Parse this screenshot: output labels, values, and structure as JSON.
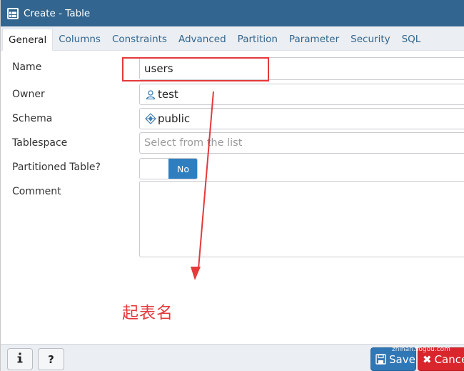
{
  "window": {
    "title": "Create - Table"
  },
  "tabs": [
    {
      "label": "General",
      "active": true
    },
    {
      "label": "Columns",
      "active": false
    },
    {
      "label": "Constraints",
      "active": false
    },
    {
      "label": "Advanced",
      "active": false
    },
    {
      "label": "Partition",
      "active": false
    },
    {
      "label": "Parameter",
      "active": false
    },
    {
      "label": "Security",
      "active": false
    },
    {
      "label": "SQL",
      "active": false
    }
  ],
  "form": {
    "name": {
      "label": "Name",
      "value": "users"
    },
    "owner": {
      "label": "Owner",
      "value": "test",
      "icon": "user-icon"
    },
    "schema": {
      "label": "Schema",
      "value": "public",
      "icon": "schema-icon"
    },
    "tablespace": {
      "label": "Tablespace",
      "placeholder": "Select from the list"
    },
    "partitioned": {
      "label": "Partitioned Table?",
      "value": "No"
    },
    "comment": {
      "label": "Comment",
      "value": ""
    }
  },
  "annotation": {
    "text": "起表名",
    "color": "#e5393b"
  },
  "footer": {
    "info_icon": "info-icon",
    "help_icon": "help-icon",
    "save_label": "Save",
    "cancel_label": "Cancel"
  },
  "watermark": {
    "line1": "zhinan.sogou.com"
  },
  "colors": {
    "titlebar": "#326690",
    "tab_link": "#326690",
    "toggle_on": "#2f7fc0",
    "save": "#3077b6",
    "cancel": "#d8262c"
  }
}
